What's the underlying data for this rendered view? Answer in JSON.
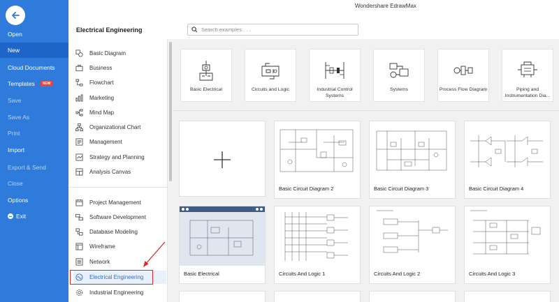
{
  "app_title": "Wondershare EdrawMax",
  "menu": {
    "items": [
      {
        "label": "Open",
        "dim": false
      },
      {
        "label": "New",
        "dim": false,
        "active": true
      },
      {
        "label": "Cloud Documents",
        "dim": false
      },
      {
        "label": "Templates",
        "dim": false,
        "badge": "NEW"
      },
      {
        "label": "Save",
        "dim": true
      },
      {
        "label": "Save As",
        "dim": true
      },
      {
        "label": "Print",
        "dim": true
      },
      {
        "label": "Import",
        "dim": false
      },
      {
        "label": "Export & Send",
        "dim": true
      },
      {
        "label": "Close",
        "dim": true
      },
      {
        "label": "Options",
        "dim": false
      },
      {
        "label": "Exit",
        "dim": false
      }
    ]
  },
  "section_title": "Electrical Engineering",
  "search": {
    "placeholder": "Search examples . . ."
  },
  "categories": {
    "group1": [
      {
        "label": "Basic Diagram",
        "icon": "shapes-icon"
      },
      {
        "label": "Business",
        "icon": "briefcase-icon"
      },
      {
        "label": "Flowchart",
        "icon": "flowchart-icon"
      },
      {
        "label": "Marketing",
        "icon": "bar-chart-icon"
      },
      {
        "label": "Mind Map",
        "icon": "mind-map-icon"
      },
      {
        "label": "Organizational Chart",
        "icon": "org-chart-icon"
      },
      {
        "label": "Management",
        "icon": "management-icon"
      },
      {
        "label": "Strategy and Planning",
        "icon": "strategy-icon"
      },
      {
        "label": "Analysis Canvas",
        "icon": "canvas-icon"
      }
    ],
    "group2": [
      {
        "label": "Project Management",
        "icon": "calendar-icon"
      },
      {
        "label": "Software Development",
        "icon": "software-icon"
      },
      {
        "label": "Database Modeling",
        "icon": "database-icon"
      },
      {
        "label": "Wireframe",
        "icon": "wireframe-icon"
      },
      {
        "label": "Network",
        "icon": "network-icon"
      },
      {
        "label": "Electrical Engineering",
        "icon": "electrical-icon",
        "selected": true
      },
      {
        "label": "Industrial Engineering",
        "icon": "industrial-icon"
      }
    ]
  },
  "subcategories": [
    {
      "label": "Basic Electrical"
    },
    {
      "label": "Circuits and Logic"
    },
    {
      "label": "Industrial Control Systems"
    },
    {
      "label": "Systems"
    },
    {
      "label": "Process Flow Diagram"
    },
    {
      "label": "Piping and Instrumentation Dia..."
    }
  ],
  "templates": [
    {
      "label": "",
      "blank": true
    },
    {
      "label": "Basic Circuit Diagram 2"
    },
    {
      "label": "Basic Circuit Diagram 3"
    },
    {
      "label": "Basic Circuit Diagram 4"
    },
    {
      "label": "Basic Electrical"
    },
    {
      "label": "Circuits And Logic 1"
    },
    {
      "label": "Circuits And Logic 2"
    },
    {
      "label": "Circuits And Logic 3"
    }
  ],
  "colors": {
    "menu_blue": "#2e7bdb",
    "selected_text": "#2e6fd0",
    "highlight_red": "#e02828",
    "badge_red": "#e8453c"
  }
}
